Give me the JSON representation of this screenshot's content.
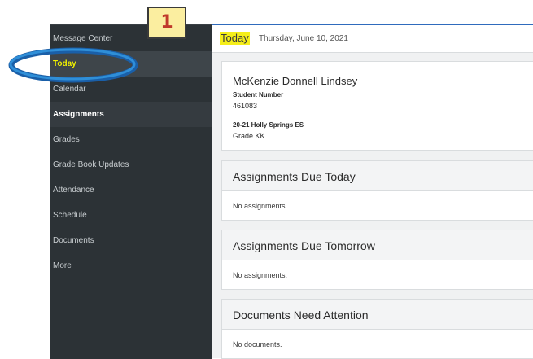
{
  "sidebar": {
    "items": [
      {
        "label": "Message Center"
      },
      {
        "label": "Today"
      },
      {
        "label": "Calendar"
      },
      {
        "label": "Assignments"
      },
      {
        "label": "Grades"
      },
      {
        "label": "Grade Book Updates"
      },
      {
        "label": "Attendance"
      },
      {
        "label": "Schedule"
      },
      {
        "label": "Documents"
      },
      {
        "label": "More"
      }
    ],
    "active_index": 1
  },
  "callout": {
    "number": "1",
    "badge_fill": "#fbeea0",
    "number_color": "#c0392b",
    "ellipse_color": "#1f7fc8"
  },
  "header": {
    "title": "Today",
    "date": "Thursday, June 10, 2021"
  },
  "student": {
    "name": "McKenzie Donnell Lindsey",
    "number_label": "Student Number",
    "number": "461083",
    "school_year": "20-21 Holly Springs ES",
    "grade": "Grade KK"
  },
  "sections": [
    {
      "title": "Assignments Due Today",
      "empty_text": "No assignments."
    },
    {
      "title": "Assignments Due Tomorrow",
      "empty_text": "No assignments."
    },
    {
      "title": "Documents Need Attention",
      "empty_text": "No documents."
    }
  ],
  "colors": {
    "sidebar_bg": "#2c3236",
    "highlight": "#f5ee1a",
    "accent_border": "#2f6bbd"
  }
}
